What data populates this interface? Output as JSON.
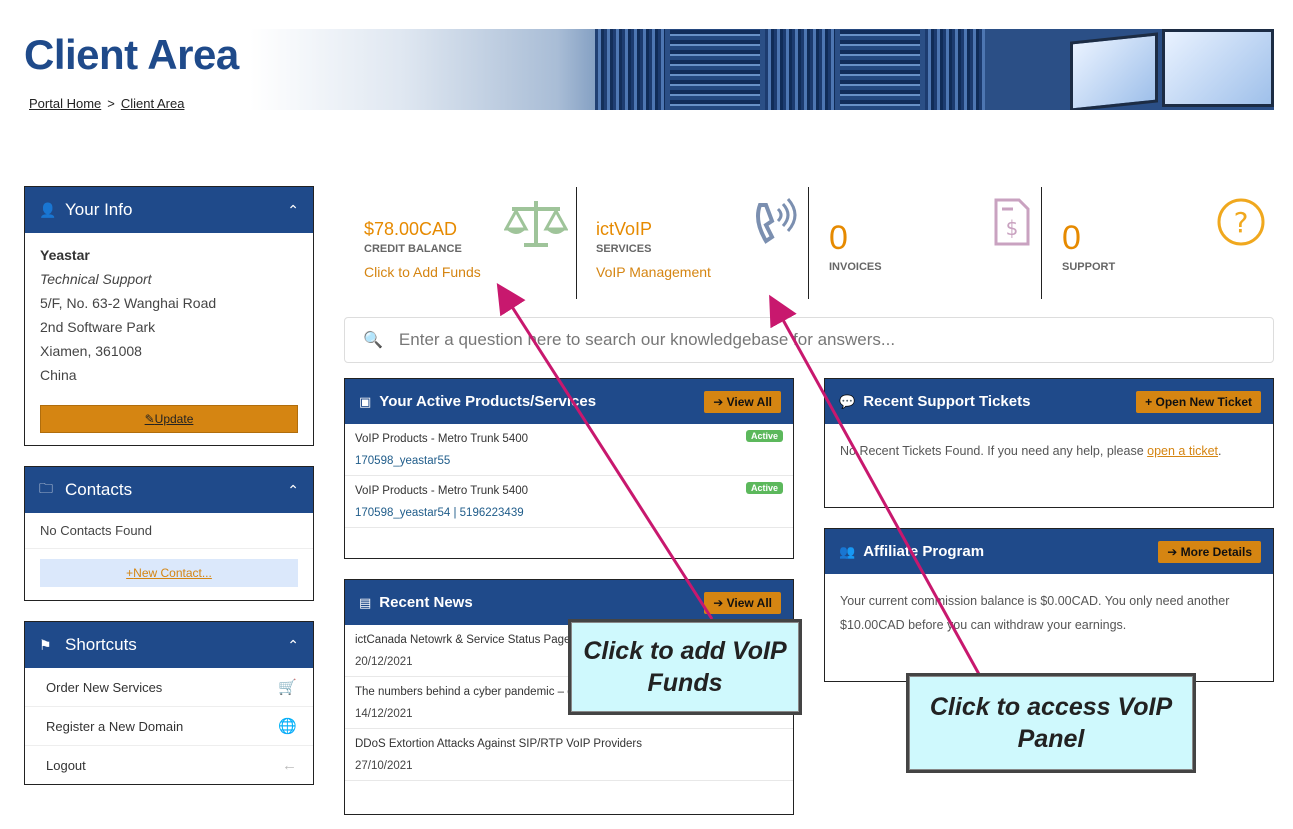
{
  "header": {
    "title": "Client Area",
    "breadcrumb": [
      "Portal Home",
      ">",
      "Client Area"
    ]
  },
  "your_info": {
    "heading": "Your Info",
    "name": "Yeastar",
    "role": "Technical Support",
    "address": [
      "5/F, No. 63-2 Wanghai Road",
      "2nd Software Park",
      "Xiamen, 361008",
      "China"
    ],
    "update_label": "Update"
  },
  "contacts": {
    "heading": "Contacts",
    "empty_text": "No Contacts Found",
    "new_contact_label": "New Contact..."
  },
  "shortcuts": {
    "heading": "Shortcuts",
    "items": [
      {
        "label": "Order New Services",
        "icon": "cart-icon"
      },
      {
        "label": "Register a New Domain",
        "icon": "globe-icon"
      },
      {
        "label": "Logout",
        "icon": "arrow-left-icon"
      }
    ]
  },
  "stats": {
    "credit": {
      "value": "$78.00CAD",
      "label": "CREDIT BALANCE",
      "link": "Click to Add Funds"
    },
    "services": {
      "value": "ictVoIP",
      "label": "SERVICES",
      "link": "VoIP Management"
    },
    "invoices": {
      "value": "0",
      "label": "INVOICES"
    },
    "support": {
      "value": "0",
      "label": "SUPPORT"
    }
  },
  "search": {
    "placeholder": "Enter a question here to search our knowledgebase for answers..."
  },
  "products": {
    "heading": "Your Active Products/Services",
    "button": "View All",
    "items": [
      {
        "name": "VoIP Products - Metro Trunk 5400",
        "sub": "170598_yeastar55",
        "status": "Active"
      },
      {
        "name": "VoIP Products - Metro Trunk 5400",
        "sub": "170598_yeastar54 | 5196223439",
        "status": "Active"
      }
    ]
  },
  "news": {
    "heading": "Recent News",
    "button": "View All",
    "items": [
      {
        "title": "ictCanada Netowrk & Service Status Page",
        "date": "20/12/2021"
      },
      {
        "title": "The numbers behind a cyber pandemic – d",
        "date": "14/12/2021"
      },
      {
        "title": "DDoS Extortion Attacks Against SIP/RTP VoIP Providers",
        "date": "27/10/2021"
      }
    ]
  },
  "tickets": {
    "heading": "Recent Support Tickets",
    "button": "Open New Ticket",
    "text_before": "No Recent Tickets Found. If you need any help, please ",
    "link": "open a ticket",
    "text_after": "."
  },
  "affiliate": {
    "heading": "Affiliate Program",
    "button": "More Details",
    "text": "Your current commission balance is $0.00CAD. You only need another $10.00CAD before you can withdraw your earnings."
  },
  "callouts": {
    "funds": "Click to add VoIP Funds",
    "panel": "Click to access VoIP Panel"
  },
  "colors": {
    "brand_blue": "#1f4a8a",
    "accent_orange": "#d58512",
    "callout_bg": "#cff9fd",
    "arrow": "#c8186e"
  }
}
